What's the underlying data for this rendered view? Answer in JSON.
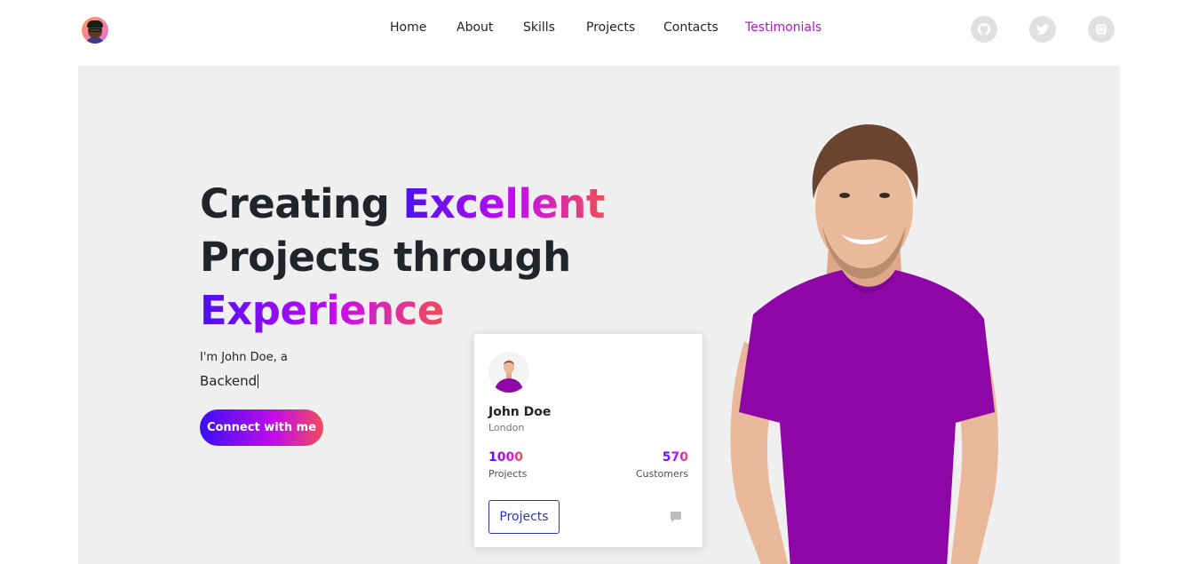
{
  "nav": {
    "links": [
      "Home",
      "About",
      "Skills",
      "Projects",
      "Contacts",
      "Testimonials"
    ],
    "active": "Testimonials",
    "social_icons": [
      "github-icon",
      "twitter-icon",
      "instagram-icon"
    ]
  },
  "hero": {
    "headline": {
      "part1": "Creating ",
      "part2": "Excellent",
      "part3": "Projects through",
      "part4": "Experience"
    },
    "intro": "I'm John Doe, a",
    "role": "Backend",
    "cta": "Connect with me"
  },
  "card": {
    "name": "John Doe",
    "city": "London",
    "stats": {
      "projects_value": "1000",
      "projects_label": "Projects",
      "customers_value": "570",
      "customers_label": "Customers"
    },
    "button": "Projects"
  },
  "colors": {
    "accent_purple": "#b015c8",
    "gradient_start": "#4a10f0",
    "gradient_mid": "#c50cf0",
    "gradient_end": "#f04d58",
    "shirt": "#8f06a6",
    "button_border": "#2c34b4"
  }
}
